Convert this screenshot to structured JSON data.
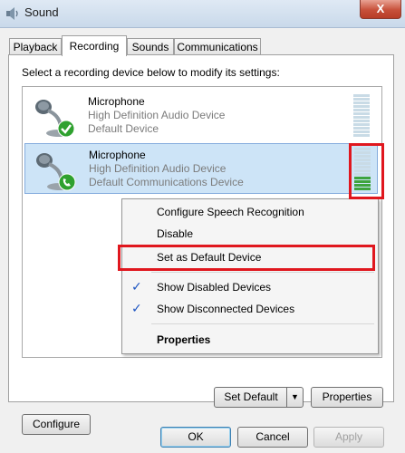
{
  "window": {
    "title": "Sound",
    "close_label": "X"
  },
  "tabs": [
    {
      "label": "Playback"
    },
    {
      "label": "Recording"
    },
    {
      "label": "Sounds"
    },
    {
      "label": "Communications"
    }
  ],
  "instruction": "Select a recording device below to modify its settings:",
  "devices": [
    {
      "name": "Microphone",
      "driver": "High Definition Audio Device",
      "status": "Default Device",
      "level_segments_on": 0
    },
    {
      "name": "Microphone",
      "driver": "High Definition Audio Device",
      "status": "Default Communications Device",
      "level_segments_on": 4
    }
  ],
  "context_menu": {
    "items": [
      {
        "label": "Configure Speech Recognition",
        "checked": false
      },
      {
        "label": "Disable",
        "checked": false
      },
      {
        "label": "Set as Default Device",
        "checked": false
      },
      {
        "label": "Show Disabled Devices",
        "checked": true
      },
      {
        "label": "Show Disconnected Devices",
        "checked": true
      },
      {
        "label": "Properties",
        "checked": false
      }
    ],
    "check_glyph": "✓"
  },
  "panel_buttons": {
    "configure": "Configure",
    "set_default": "Set Default",
    "set_default_arrow": "▼",
    "properties": "Properties"
  },
  "dialog_buttons": {
    "ok": "OK",
    "cancel": "Cancel",
    "apply": "Apply"
  },
  "colors": {
    "highlight": "#e0171e",
    "selection": "#cde4f7",
    "level_on": "#3ea43e"
  }
}
